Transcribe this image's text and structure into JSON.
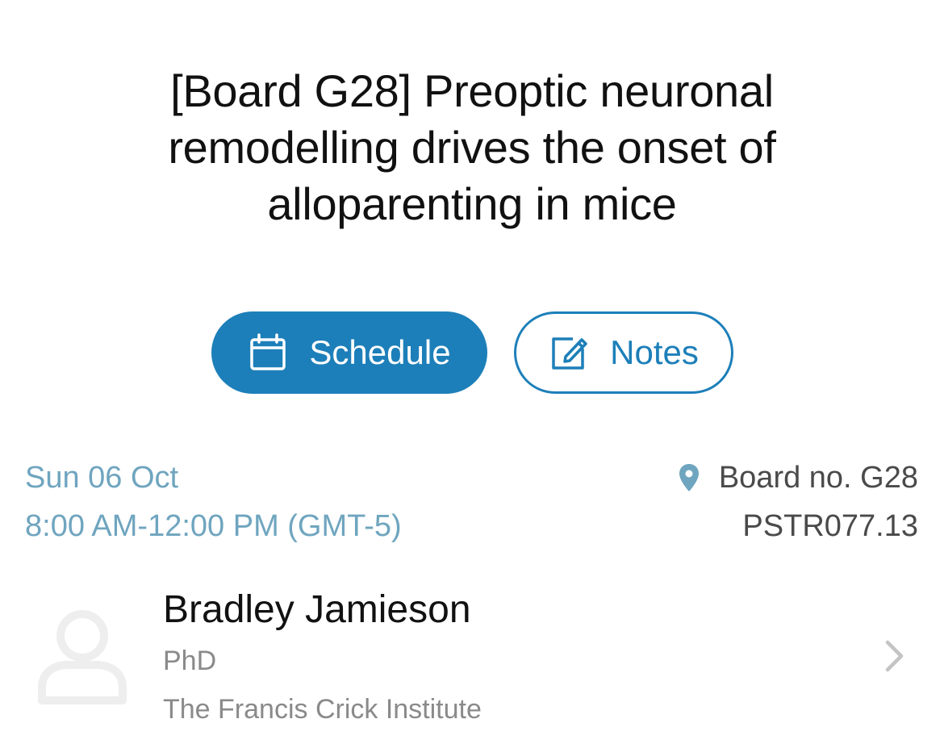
{
  "poster": {
    "title": "[Board G28] Preoptic neuronal remodelling drives the onset of alloparenting in mice"
  },
  "actions": {
    "schedule_label": "Schedule",
    "notes_label": "Notes"
  },
  "session": {
    "date": "Sun 06 Oct",
    "time": "8:00 AM-12:00 PM (GMT-5)",
    "board": "Board no. G28",
    "code": "PSTR077.13"
  },
  "author": {
    "name": "Bradley Jamieson",
    "degree": "PhD",
    "institution": "The Francis Crick Institute"
  },
  "colors": {
    "accent": "#1d7fb9",
    "date_text": "#6fa5bf",
    "secondary_text": "#8a8a8a"
  },
  "icons": {
    "schedule": "calendar-icon",
    "notes": "edit-note-icon",
    "location": "map-pin-icon",
    "avatar": "person-placeholder-icon",
    "disclosure": "chevron-right-icon"
  }
}
